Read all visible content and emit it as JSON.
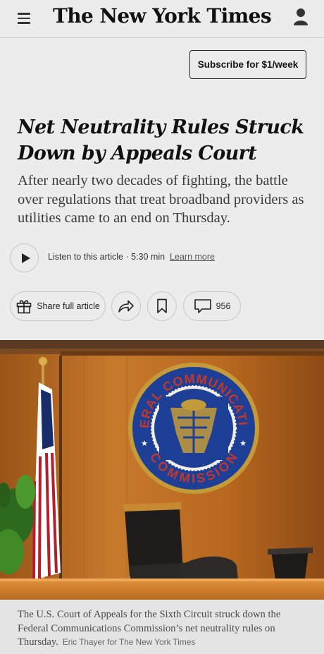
{
  "header": {
    "masthead": "The New York Times"
  },
  "subscribe": {
    "label": "Subscribe for $1/week"
  },
  "article": {
    "headline_line1": "Net Neutrality Rules Struck",
    "headline_line2": "Down by Appeals Court",
    "summary": "After nearly two decades of fighting, the battle over regulations that treat broadband providers as utilities came to an end on Thursday."
  },
  "audio": {
    "listen_text": "Listen to this article · 5:30 min",
    "learn_more": "Learn more"
  },
  "actions": {
    "share_label": "Share full article",
    "comment_count": "956"
  },
  "photo": {
    "seal_top_text": "FEDERAL COMMUNICATIONS",
    "seal_bottom_text": "COMMISSION"
  },
  "caption": {
    "text": "The U.S. Court of Appeals for the Sixth Circuit struck down the Federal Communications Commission’s net neutrality rules on Thursday.",
    "credit": "Eric Thayer for The New York Times"
  },
  "colors": {
    "background": "#ececec",
    "text": "#121212",
    "seal_blue": "#1e3f96",
    "seal_red": "#c2372b",
    "seal_gold": "#c59b3a",
    "wood": "#b96b23"
  }
}
